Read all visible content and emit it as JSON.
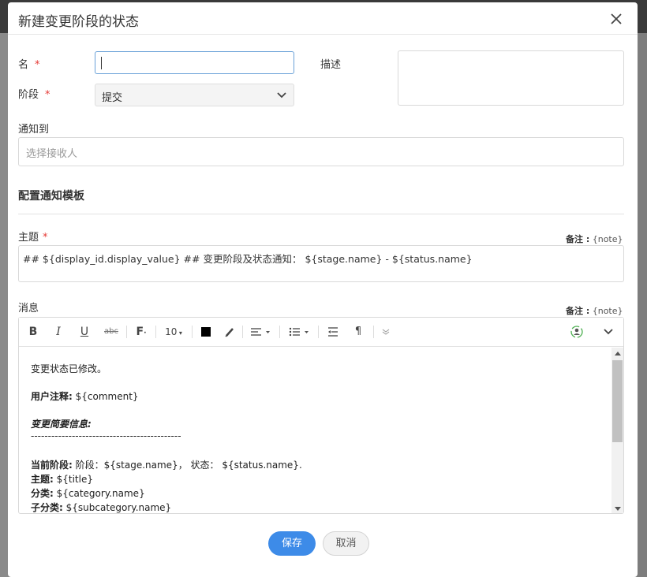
{
  "dialog": {
    "title": "新建变更阶段的状态",
    "close_icon": "close-icon"
  },
  "form": {
    "name_label": "名",
    "required_mark": "*",
    "name_value": "",
    "description_label": "描述",
    "stage_label": "阶段",
    "stage_value": "提交",
    "notify_label": "通知到",
    "notify_placeholder": "选择接收人"
  },
  "template": {
    "section_title": "配置通知模板",
    "subject_label": "主题",
    "note_label": "备注 :",
    "note_value": "{note}",
    "subject_value": "## ${display_id.display_value}  ## 变更阶段及状态通知：  ${stage.name}  - ${status.name}",
    "message_label": "消息"
  },
  "toolbar": {
    "bold": "B",
    "italic": "I",
    "underline": "U",
    "strikethrough": "abc",
    "font": "F",
    "font_size": "10",
    "text_color": "#000000"
  },
  "message_content": {
    "line1": "变更状态已修改。",
    "comment_label": "用户注释:",
    "comment_value": " ${comment}",
    "summary_title": "变更简要信息:",
    "separator": "--------------------------------------------",
    "current_stage_label": "当前阶段:",
    "current_stage_value": " 阶段：${stage.name}，  状态：  ${status.name}.",
    "title_label": "主题:",
    "title_value": " ${title}",
    "category_label": "分类:",
    "category_value": " ${category.name}",
    "subcategory_label": "子分类:",
    "subcategory_value": " ${subcategory.name}"
  },
  "buttons": {
    "save": "保存",
    "cancel": "取消"
  },
  "colors": {
    "primary": "#3d8be8",
    "required": "#e53935"
  }
}
